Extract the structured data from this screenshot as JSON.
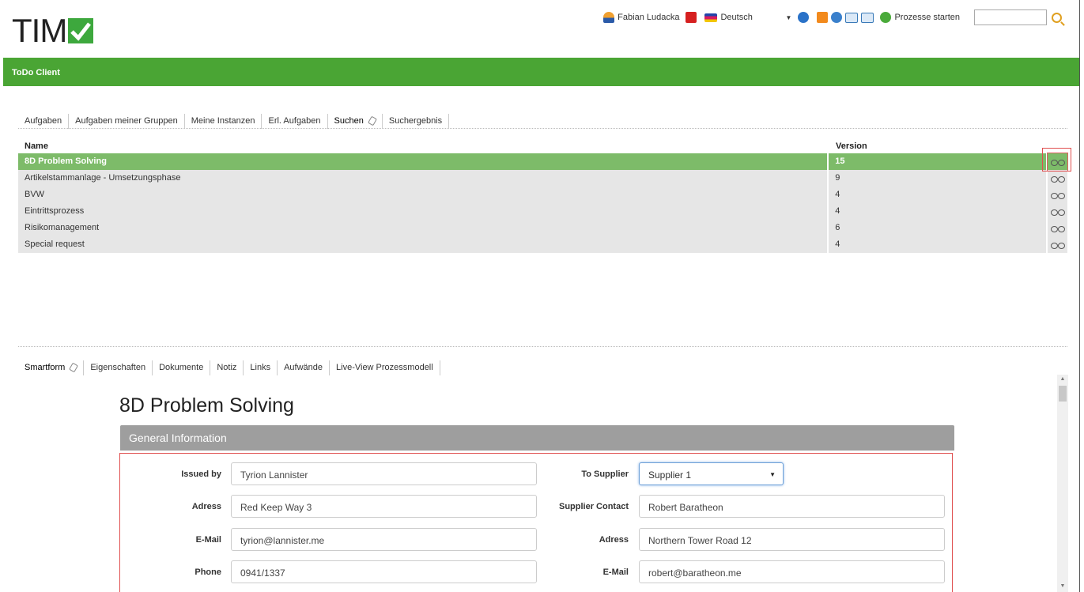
{
  "header": {
    "logo_text": "TIM",
    "user_name": "Fabian Ludacka",
    "language": "Deutsch",
    "start_processes": "Prozesse starten",
    "search_value": ""
  },
  "app_title": "ToDo Client",
  "top_tabs": [
    {
      "label": "Aufgaben"
    },
    {
      "label": "Aufgaben meiner Gruppen"
    },
    {
      "label": "Meine Instanzen"
    },
    {
      "label": "Erl. Aufgaben"
    },
    {
      "label": "Suchen"
    },
    {
      "label": "Suchergebnis"
    }
  ],
  "grid": {
    "columns": {
      "name": "Name",
      "version": "Version"
    },
    "rows": [
      {
        "name": "8D Problem Solving",
        "version": "15"
      },
      {
        "name": "Artikelstammanlage - Umsetzungsphase",
        "version": "9"
      },
      {
        "name": "BVW",
        "version": "4"
      },
      {
        "name": "Eintrittsprozess",
        "version": "4"
      },
      {
        "name": "Risikomanagement",
        "version": "6"
      },
      {
        "name": "Special request",
        "version": "4"
      }
    ]
  },
  "bottom_tabs": [
    {
      "label": "Smartform"
    },
    {
      "label": "Eigenschaften"
    },
    {
      "label": "Dokumente"
    },
    {
      "label": "Notiz"
    },
    {
      "label": "Links"
    },
    {
      "label": "Aufwände"
    },
    {
      "label": "Live-View Prozessmodell"
    }
  ],
  "form": {
    "title": "8D Problem Solving",
    "section": "General Information",
    "left": [
      {
        "label": "Issued by",
        "value": "Tyrion Lannister"
      },
      {
        "label": "Adress",
        "value": "Red Keep Way 3"
      },
      {
        "label": "E-Mail",
        "value": "tyrion@lannister.me"
      },
      {
        "label": "Phone",
        "value": "0941/1337"
      }
    ],
    "right": [
      {
        "label": "To Supplier",
        "value": "Supplier 1"
      },
      {
        "label": "Supplier Contact",
        "value": "Robert Baratheon"
      },
      {
        "label": "Adress",
        "value": "Northern Tower Road 12"
      },
      {
        "label": "E-Mail",
        "value": "robert@baratheon.me"
      }
    ]
  },
  "colors": {
    "brand_green": "#4aa534",
    "selected_row": "#7dbb69",
    "section_gray": "#9e9e9e"
  }
}
